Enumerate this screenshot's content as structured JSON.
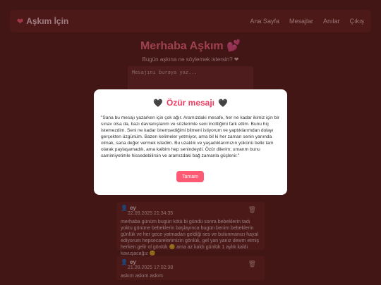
{
  "brand": {
    "name": "Aşkım İçin"
  },
  "nav": {
    "links": [
      "Ana Sayfa",
      "Mesajlar",
      "Anılar",
      "Çıkış"
    ]
  },
  "page": {
    "title": "Merhaba Aşkım 💕",
    "subtitle": "Bugün aşkına ne söylemek istersin? ❤",
    "compose_placeholder": "Mesajını buraya yaz..."
  },
  "messages": [
    {
      "author": "ey",
      "date": "22.09.2025 21:34:35",
      "body": "merhaba günüm bugün kötü bi gündü sonra bebeklerin tadı yoktu gününe bebeklerin başlayınca bugün benim bebeklerin günlük ve her gece yatmadan geldiği ses ve bulunmanızı hayal ediyorum hepsecarelerimizin gönlük, gel yan yanız dewm etmiş herken gelir ol gönlük 😊 ama az kaldı günlük 1 aylık kaldı kavuşacağız 😊"
    },
    {
      "author": "ey",
      "date": "21.09.2025 17:02:38",
      "body": "askım askım askım"
    }
  ],
  "modal": {
    "title": "Özür mesajı",
    "text": "\"Sana bu mesajı yazarken için çok ağır. Aramızdaki mesafe, her ne kadar ikimiz için bir sınav olsa da, bazı davranışlarım ve sözlerimle seni incittiğimi fark ettim. Bunu hiç istemezdim. Seni ne kadar önemsediğimi bilmeni istiyorum ve yaptıklarımdan dolayı gerçekten üzgünüm. Bazen kelimeler yetmiyor, ama bil ki her zaman senin yanında olmak, sana değer vermek istedim. Bu uzaklık ve yaşadıklarımızın yükünü belki tam olarak paylaşamadık, ama kalbim hep senindeydi. Özür dilerim; umarım bunu samimiyetimle hissedebilirsin ve aramızdaki bağ zamanla güçlenir.\"",
    "button": "Tamam"
  },
  "colors": {
    "accent": "#ef3b61",
    "button": "#ff5a73",
    "background": "#5a1f1f"
  }
}
